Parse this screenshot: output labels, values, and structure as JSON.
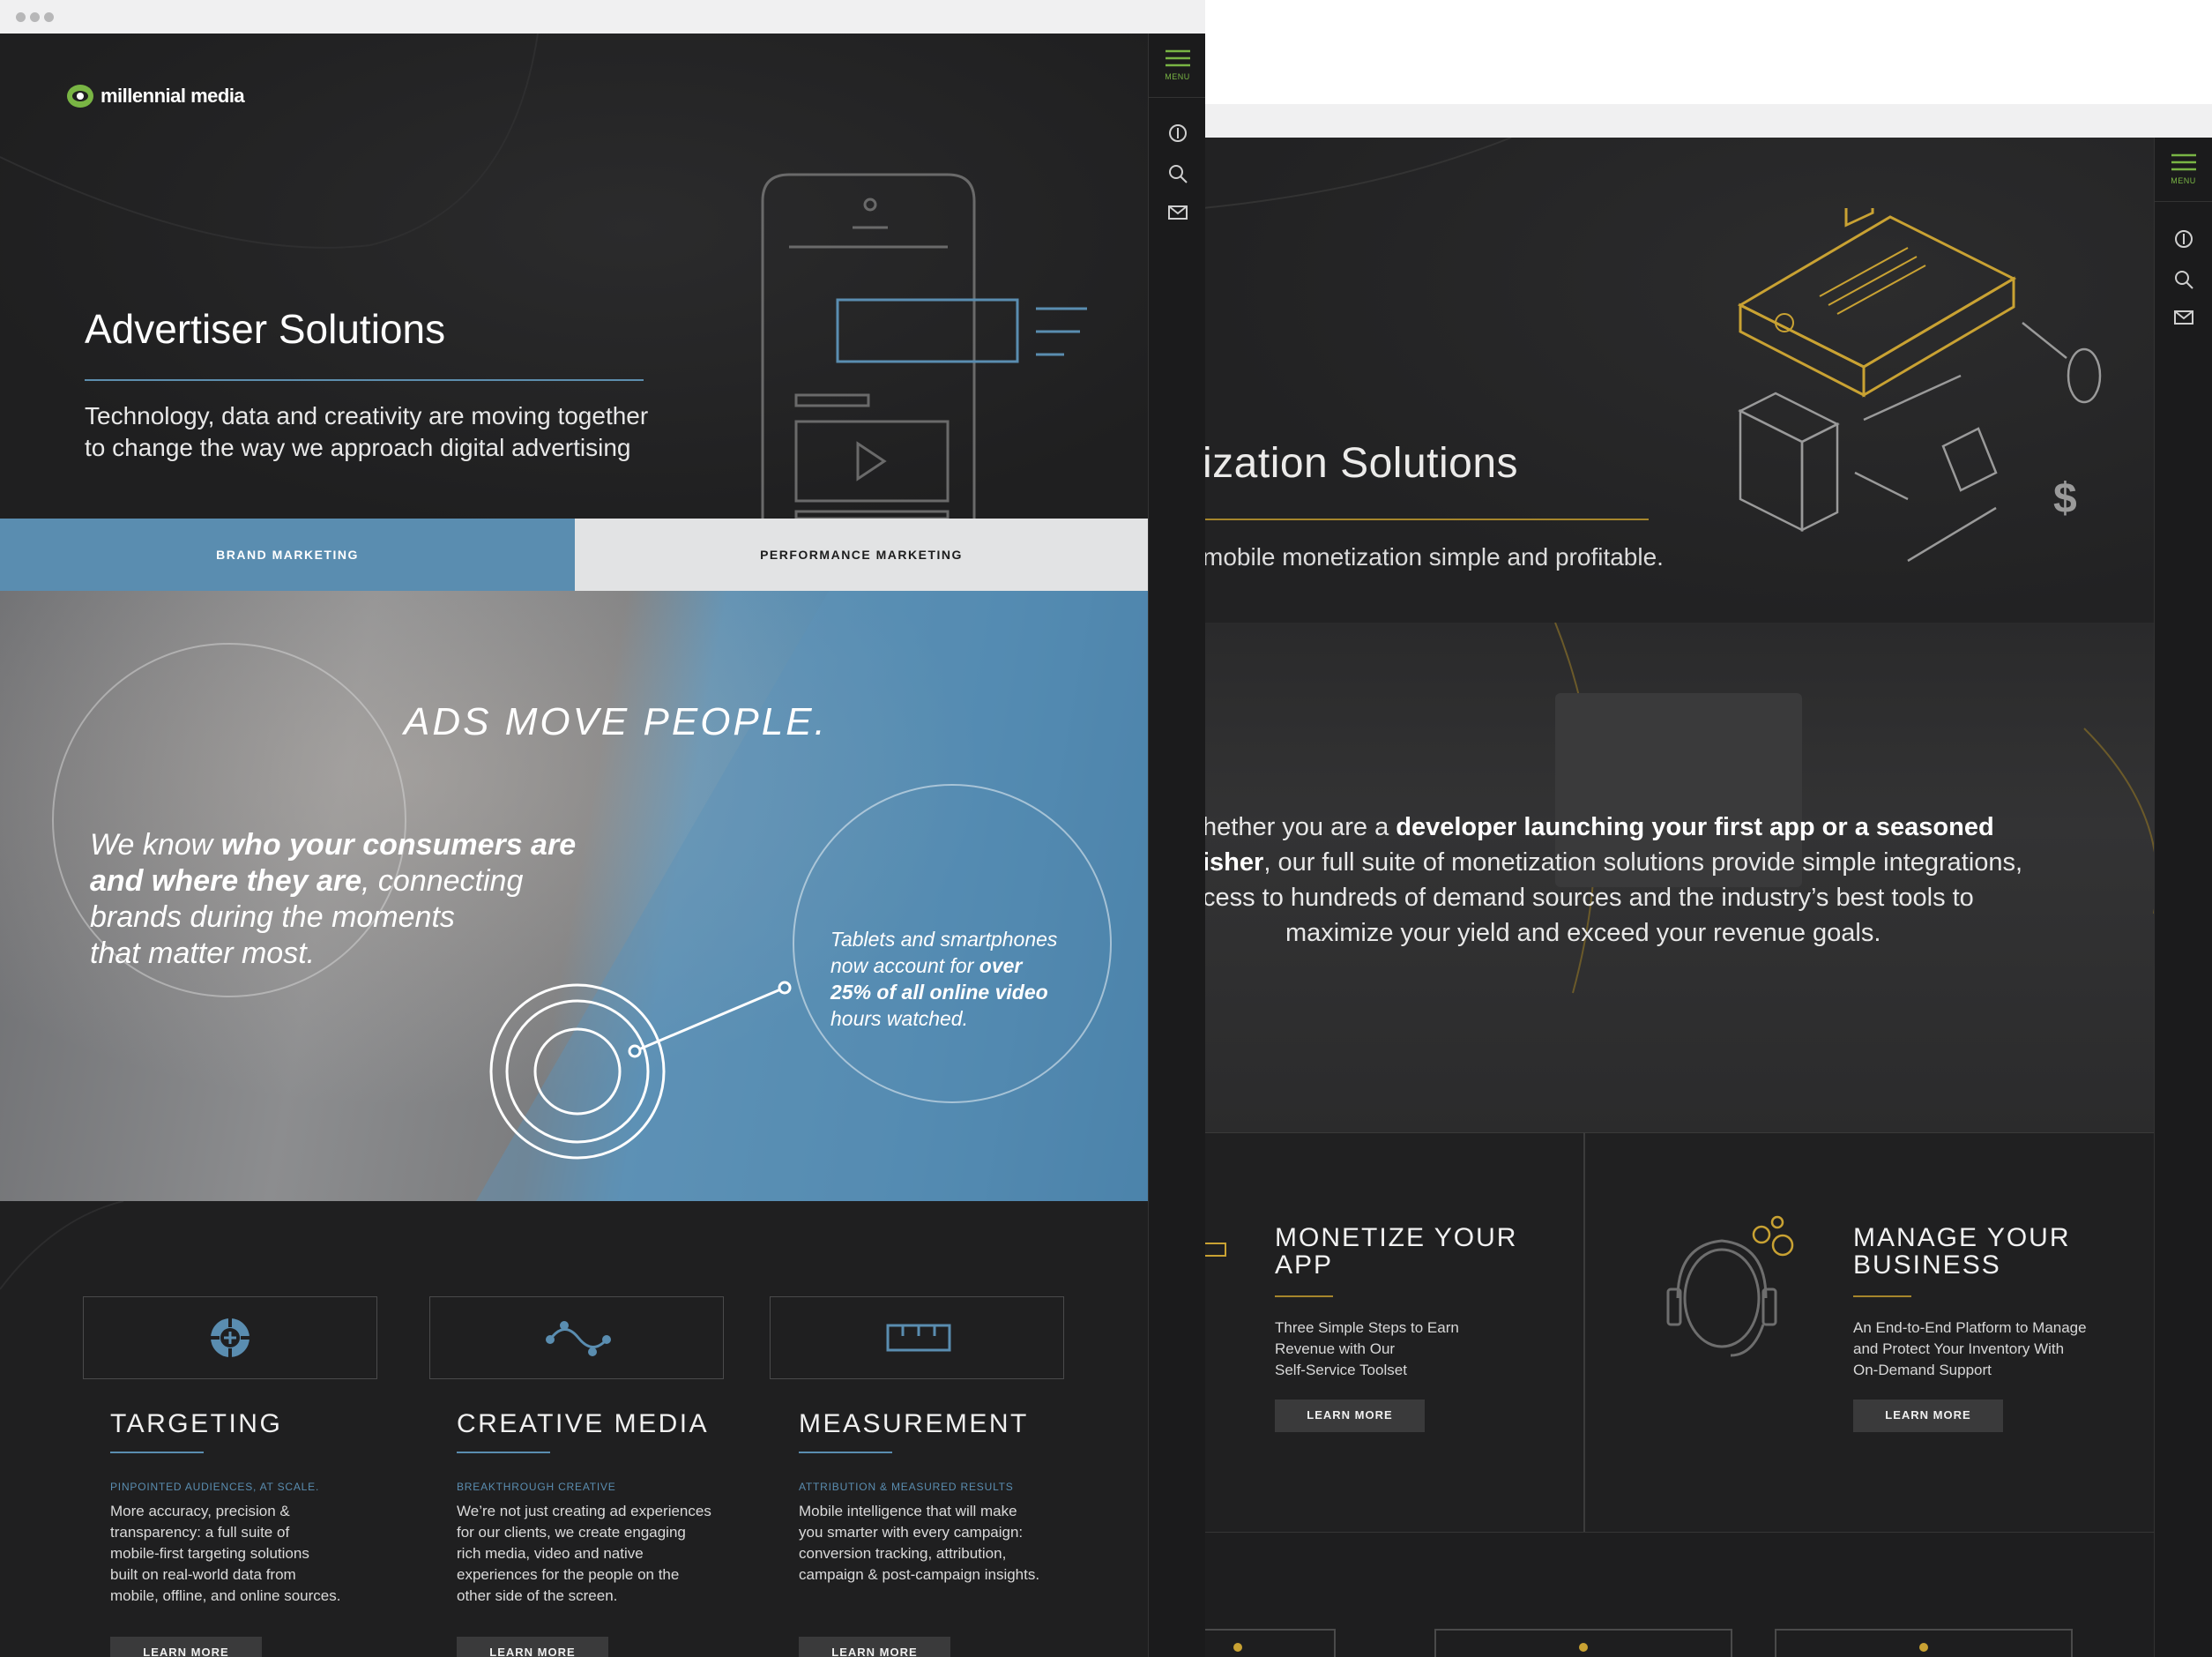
{
  "back_window": {
    "title_partial": "ization Solutions",
    "subtitle_partial": "mobile monetization simple and profitable.",
    "photo_text": {
      "line1_pre": "hether you are a ",
      "line1_bold": "developer launching your first app or a seasoned",
      "line2_bold": "isher",
      "line2_post": ", our full suite of monetization solutions provide simple integrations,",
      "line3": "cess to hundreds of demand sources and the industry’s best tools to",
      "line4": "maximize your yield and exceed your revenue goals."
    },
    "cards": [
      {
        "title_line1": "MONETIZE YOUR",
        "title_line2": "APP",
        "desc_lines": [
          "Three Simple Steps to Earn",
          "Revenue with Our",
          "Self-Service Toolset"
        ],
        "button": "LEARN MORE"
      },
      {
        "title_line1": "MANAGE YOUR",
        "title_line2": "BUSINESS",
        "desc_lines": [
          "An End-to-End Platform to Manage",
          "and Protect Your Inventory With",
          "On-Demand Support"
        ],
        "button": "LEARN MORE"
      }
    ],
    "sidebar": {
      "menu_label": "MENU"
    }
  },
  "front_window": {
    "logo_text": "millennial media",
    "hero": {
      "title": "Advertiser Solutions",
      "subtitle_line1": "Technology, data and creativity are moving together",
      "subtitle_line2": "to change the way we approach digital advertising"
    },
    "tabs": [
      {
        "label": "BRAND MARKETING",
        "active": true
      },
      {
        "label": "PERFORMANCE MARKETING",
        "active": false
      }
    ],
    "promo": {
      "headline": "ADS MOVE PEOPLE.",
      "left": {
        "l1_pre": "We know ",
        "l1_bold": "who your consumers are",
        "l2_bold": "and where they are",
        "l2_post": ", connecting",
        "l3": "brands during the moments",
        "l4": "that matter most."
      },
      "right": {
        "l1": "Tablets and smartphones",
        "l2_pre": "now account for ",
        "l2_bold": "over",
        "l3_bold": "25% of all online video",
        "l4": "hours watched."
      }
    },
    "features": [
      {
        "title": "TARGETING",
        "kicker": "PINPOINTED AUDIENCES, AT SCALE.",
        "desc_lines": [
          "More accuracy, precision &",
          "transparency: a full suite of",
          "mobile-first targeting solutions",
          "built on real-world data from",
          "mobile, offline, and online sources."
        ],
        "button": "LEARN MORE",
        "icon": "target-icon"
      },
      {
        "title": "CREATIVE MEDIA",
        "kicker": "BREAKTHROUGH CREATIVE",
        "desc_lines": [
          "We’re not just creating ad experiences",
          "for our clients, we create engaging",
          "rich media, video and native",
          "experiences for the people on the",
          "other side of the screen."
        ],
        "button": "LEARN MORE",
        "icon": "wave-nodes-icon"
      },
      {
        "title": "MEASUREMENT",
        "kicker": "ATTRIBUTION & MEASURED RESULTS",
        "desc_lines": [
          "Mobile intelligence that will make",
          "you smarter with every campaign:",
          "conversion tracking, attribution,",
          "campaign & post-campaign insights."
        ],
        "button": "LEARN MORE",
        "icon": "ruler-icon"
      }
    ],
    "sidebar": {
      "menu_label": "MENU"
    }
  },
  "colors": {
    "blue_accent": "#5a8db0",
    "gold_accent": "#a6862c",
    "menu_green": "#79b544",
    "dark_bg": "#1f1f20"
  }
}
